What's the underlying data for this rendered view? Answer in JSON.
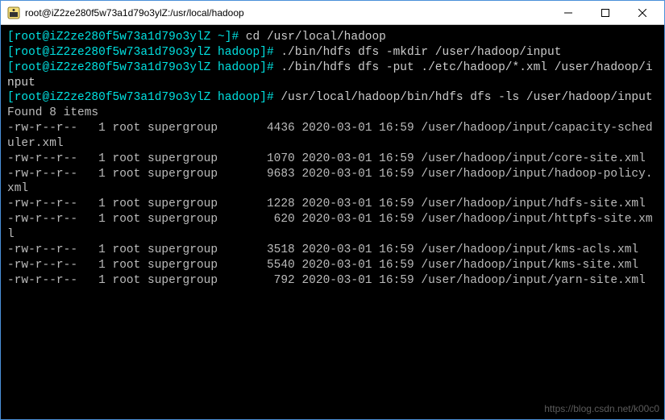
{
  "window": {
    "title": "root@iZ2ze280f5w73a1d79o3ylZ:/usr/local/hadoop"
  },
  "prompts": {
    "p1_host": "[root@iZ2ze280f5w73a1d79o3ylZ ~]#",
    "p1_cmd": " cd /usr/local/hadoop",
    "p2_host": "[root@iZ2ze280f5w73a1d79o3ylZ hadoop]#",
    "p2_cmd": " ./bin/hdfs dfs -mkdir /user/hadoop/input",
    "p3_host": "[root@iZ2ze280f5w73a1d79o3ylZ hadoop]#",
    "p3_cmd": " ./bin/hdfs dfs -put ./etc/hadoop/*.xml /user/hadoop/input",
    "p4_host": "[root@iZ2ze280f5w73a1d79o3ylZ hadoop]#",
    "p4_cmd": " /usr/local/hadoop/bin/hdfs dfs -ls /user/hadoop/input"
  },
  "output": {
    "found": "Found 8 items",
    "rows": [
      "-rw-r--r--   1 root supergroup       4436 2020-03-01 16:59 /user/hadoop/input/capacity-scheduler.xml",
      "-rw-r--r--   1 root supergroup       1070 2020-03-01 16:59 /user/hadoop/input/core-site.xml",
      "-rw-r--r--   1 root supergroup       9683 2020-03-01 16:59 /user/hadoop/input/hadoop-policy.xml",
      "-rw-r--r--   1 root supergroup       1228 2020-03-01 16:59 /user/hadoop/input/hdfs-site.xml",
      "-rw-r--r--   1 root supergroup        620 2020-03-01 16:59 /user/hadoop/input/httpfs-site.xml",
      "-rw-r--r--   1 root supergroup       3518 2020-03-01 16:59 /user/hadoop/input/kms-acls.xml",
      "-rw-r--r--   1 root supergroup       5540 2020-03-01 16:59 /user/hadoop/input/kms-site.xml",
      "-rw-r--r--   1 root supergroup        792 2020-03-01 16:59 /user/hadoop/input/yarn-site.xml"
    ]
  },
  "watermark": "https://blog.csdn.net/k00c0"
}
